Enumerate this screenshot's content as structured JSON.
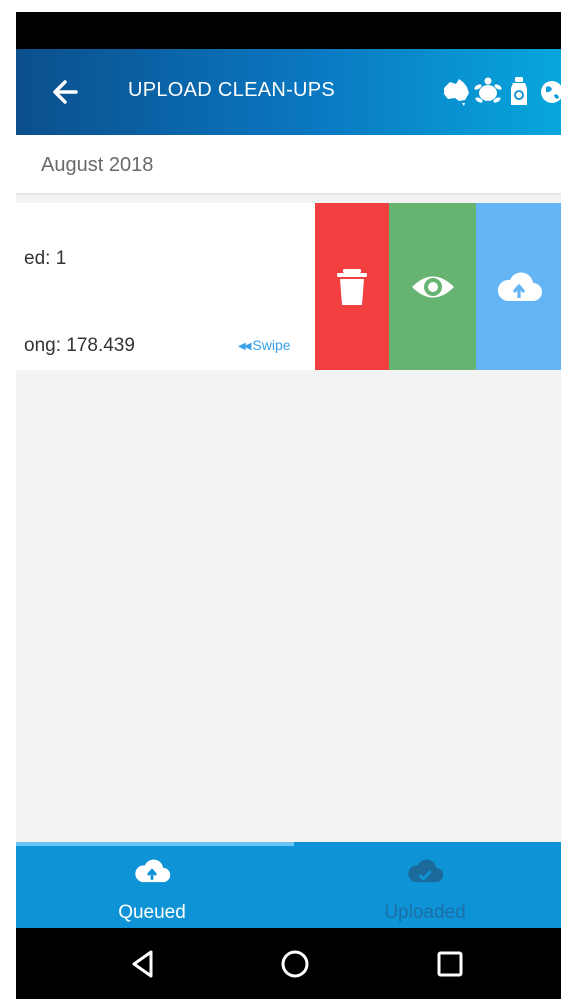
{
  "app_bar": {
    "title": "UPLOAD CLEAN-UPS",
    "back_icon": "arrow-left-icon",
    "brand_icons": [
      "australia-map-icon",
      "turtle-icon",
      "recycle-bottle-icon",
      "globe-icon"
    ]
  },
  "list": {
    "month_header": "August 2018",
    "item": {
      "line1": "ed: 1",
      "line2": "ong: 178.439",
      "swipe_hint": "Swipe",
      "actions": [
        {
          "name": "delete",
          "icon": "trash-icon",
          "color": "#f1403f"
        },
        {
          "name": "view",
          "icon": "eye-icon",
          "color": "#67b472"
        },
        {
          "name": "upload",
          "icon": "cloud-upload-icon",
          "color": "#64b5f6"
        }
      ]
    }
  },
  "bottom_nav": {
    "tabs": [
      {
        "label": "Queued",
        "icon": "cloud-upload-icon",
        "active": true
      },
      {
        "label": "Uploaded",
        "icon": "cloud-check-icon",
        "active": false
      }
    ]
  },
  "system_nav": {
    "buttons": [
      "back-triangle-icon",
      "home-circle-icon",
      "recents-square-icon"
    ]
  },
  "colors": {
    "app_bar_start": "#0b4f8c",
    "app_bar_end": "#08a6dc",
    "delete": "#f1403f",
    "view": "#67b472",
    "upload": "#64b5f6",
    "bottom_nav": "#0e93d6"
  }
}
